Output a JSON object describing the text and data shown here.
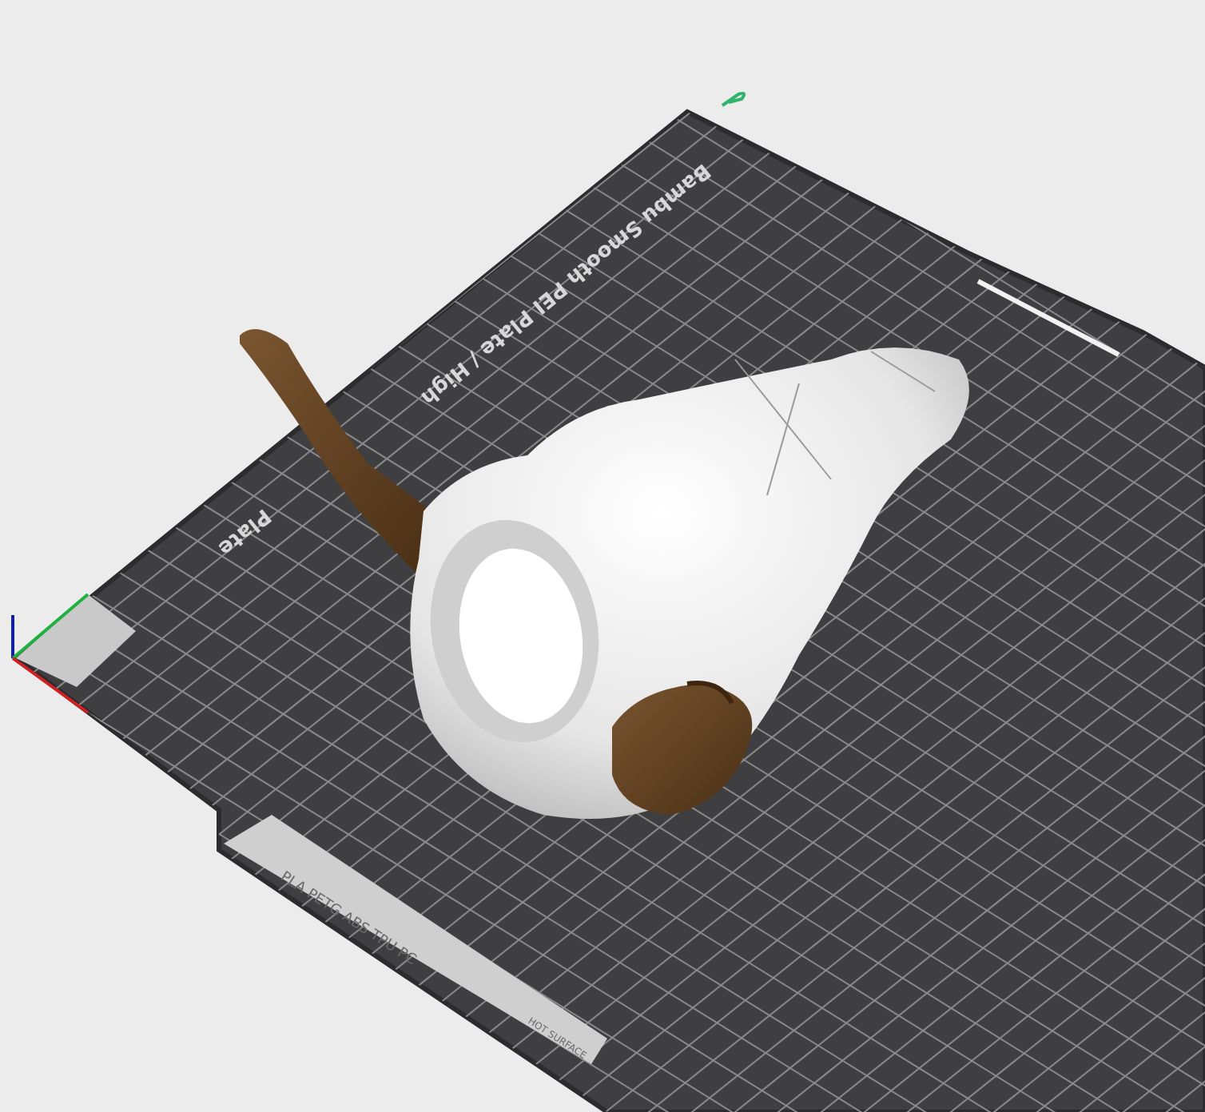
{
  "viewport": {
    "plate": {
      "name_labels": [
        "Bambu Smooth PEI Plate / High",
        "Plate"
      ],
      "filament_label": "PLA PETG ABS TPU PC",
      "warning_label": "HOT SURFACE"
    }
  }
}
